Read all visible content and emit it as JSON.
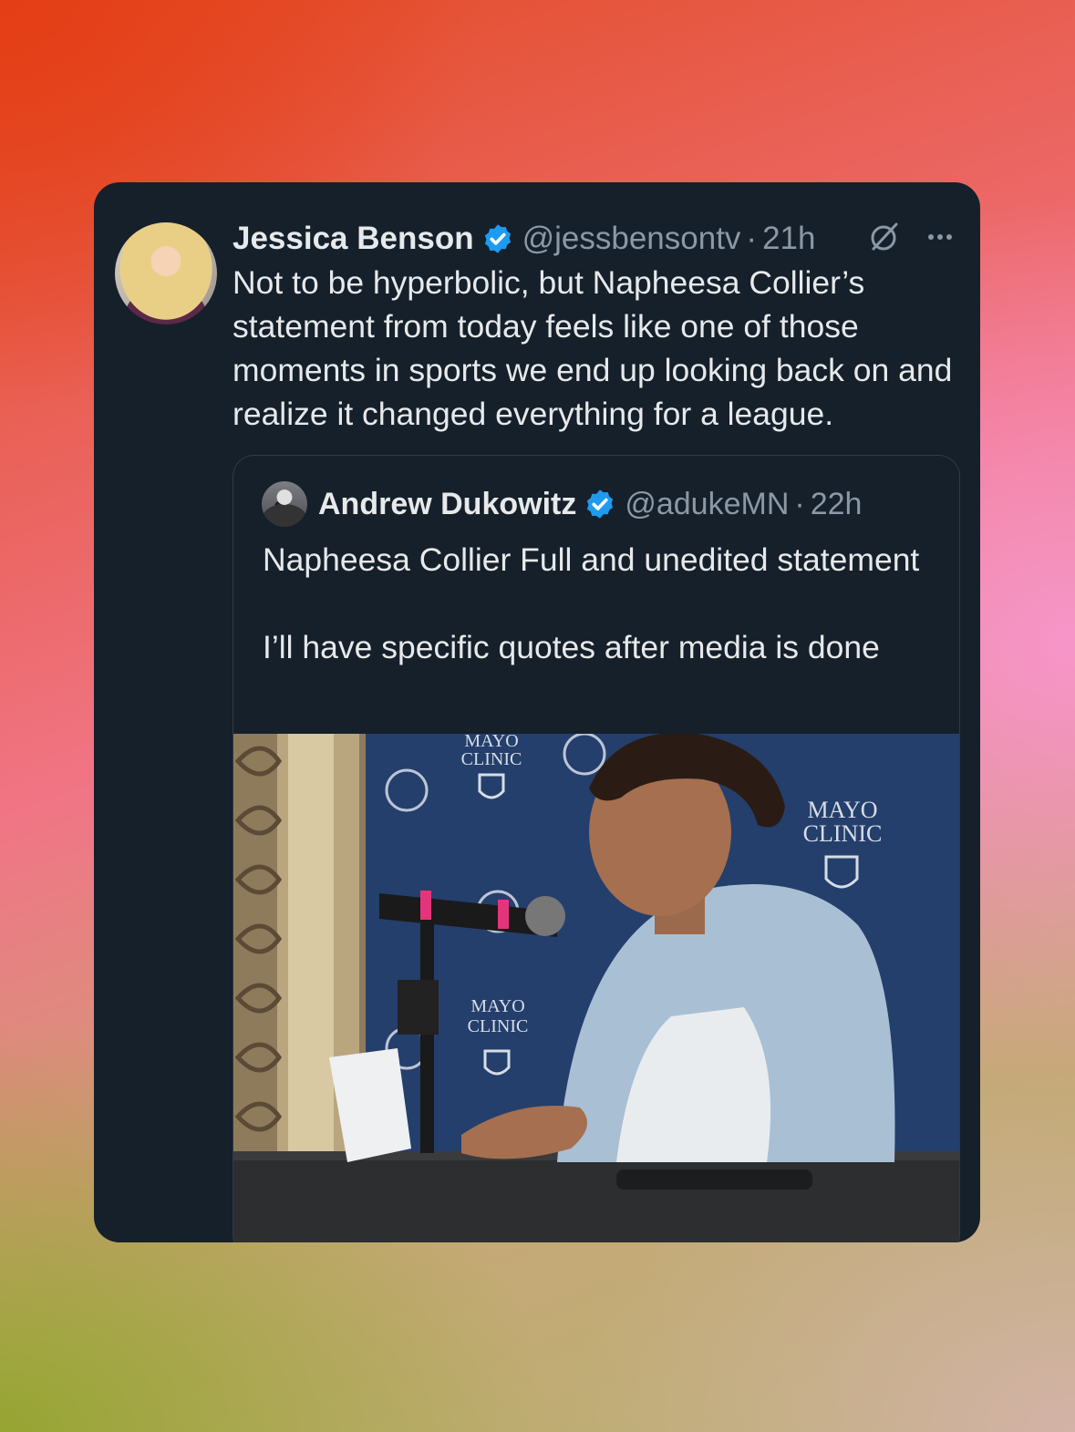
{
  "tweet": {
    "author_name": "Jessica Benson",
    "handle": "@jessbensontv",
    "separator": "·",
    "time": "21h",
    "text": "Not to be hyperbolic, but Napheesa Collier’s statement from today feels like one of those moments in sports we end up looking back on and realize it changed everything for a league.",
    "icons": {
      "avatar": "avatar",
      "verified": "verified-badge-icon",
      "grok": "grok-icon",
      "more": "more-icon"
    }
  },
  "quoted_tweet": {
    "author_name": "Andrew Dukowitz",
    "handle": "@adukeMN",
    "separator": "·",
    "time": "22h",
    "text_line1": "Napheesa Collier Full and unedited statement",
    "text_line2": "I’ll have specific quotes after media is done",
    "media": {
      "backdrop_logo_texts": [
        "MAYO",
        "CLINIC"
      ],
      "icon": "press-conference-video"
    }
  },
  "colors": {
    "card_bg": "#15202b",
    "text_primary": "#e7e9ea",
    "text_secondary": "#8b98a5",
    "verified_blue": "#1d9bf0"
  }
}
